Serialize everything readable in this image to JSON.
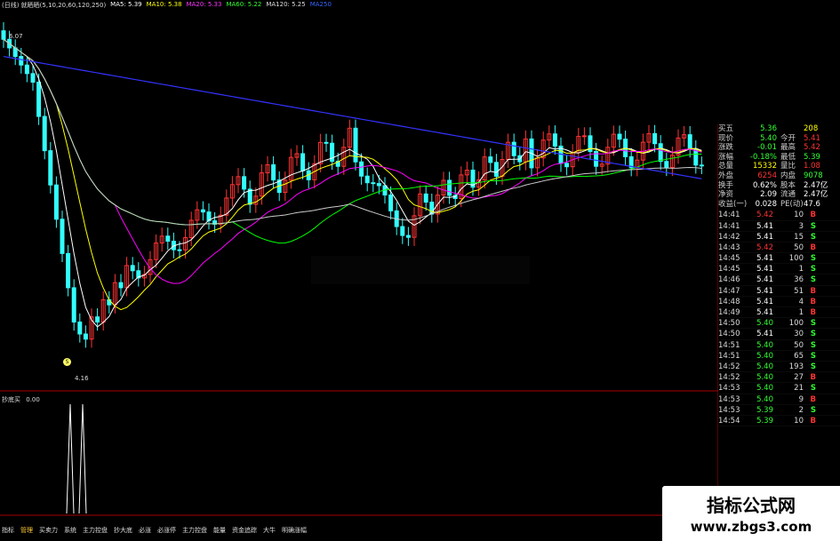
{
  "header": {
    "title": "(日线) 就晒晒(5,10,20,60,120,250)",
    "items": [
      {
        "label": "MA5: 5.39",
        "color": "#ffffff"
      },
      {
        "label": "MA10: 5.38",
        "color": "#ffff00"
      },
      {
        "label": "MA20: 5.33",
        "color": "#ff00ff"
      },
      {
        "label": "MA60: 5.22",
        "color": "#00ff00"
      },
      {
        "label": "MA120: 5.25",
        "color": "#cccccc"
      },
      {
        "label": "MA250",
        "color": "#3333ff"
      }
    ]
  },
  "price_labels": {
    "high": "6.07",
    "low": "4.16"
  },
  "low_marker": "S",
  "sub_chart": {
    "title": "抄底买",
    "value": "0.00"
  },
  "quote": {
    "rows": [
      {
        "l1": "买五",
        "v1": "5.36",
        "l2": "",
        "v2": "208",
        "c1": "#33ff33",
        "c2": "#ffff00"
      },
      {
        "l1": "现价",
        "v1": "5.40",
        "l2": "今开",
        "v2": "5.41",
        "c1": "#33ff33",
        "c2": "#ff3333"
      },
      {
        "l1": "涨跌",
        "v1": "-0.01",
        "l2": "最高",
        "v2": "5.42",
        "c1": "#33ff33",
        "c2": "#ff3333"
      },
      {
        "l1": "涨幅",
        "v1": "-0.18%",
        "l2": "最低",
        "v2": "5.39",
        "c1": "#33ff33",
        "c2": "#33ff33"
      },
      {
        "l1": "总量",
        "v1": "15332",
        "l2": "量比",
        "v2": "1.08",
        "c1": "#ffff00",
        "c2": "#ff3333"
      },
      {
        "l1": "外盘",
        "v1": "6254",
        "l2": "内盘",
        "v2": "9078",
        "c1": "#ff3333",
        "c2": "#33ff33"
      },
      {
        "l1": "换手",
        "v1": "0.62%",
        "l2": "股本",
        "v2": "2.47亿",
        "c1": "#ffffff",
        "c2": "#ffffff"
      },
      {
        "l1": "净资",
        "v1": "2.09",
        "l2": "流通",
        "v2": "2.47亿",
        "c1": "#ffffff",
        "c2": "#ffffff"
      },
      {
        "l1": "收益(一)",
        "v1": "0.028",
        "l2": "PE(动)",
        "v2": "47.6",
        "c1": "#ffffff",
        "c2": "#ffffff"
      }
    ],
    "ticks": [
      {
        "time": "14:41",
        "price": "5.42",
        "vol": "10",
        "side": "B"
      },
      {
        "time": "14:41",
        "price": "5.41",
        "vol": "3",
        "side": "S"
      },
      {
        "time": "14:42",
        "price": "5.41",
        "vol": "15",
        "side": "S"
      },
      {
        "time": "14:43",
        "price": "5.42",
        "vol": "50",
        "side": "B"
      },
      {
        "time": "14:45",
        "price": "5.41",
        "vol": "100",
        "side": "S"
      },
      {
        "time": "14:45",
        "price": "5.41",
        "vol": "1",
        "side": "S"
      },
      {
        "time": "14:46",
        "price": "5.41",
        "vol": "36",
        "side": "S"
      },
      {
        "time": "14:47",
        "price": "5.41",
        "vol": "51",
        "side": "B"
      },
      {
        "time": "14:48",
        "price": "5.41",
        "vol": "4",
        "side": "B"
      },
      {
        "time": "14:49",
        "price": "5.41",
        "vol": "1",
        "side": "B"
      },
      {
        "time": "14:50",
        "price": "5.40",
        "vol": "100",
        "side": "S"
      },
      {
        "time": "14:50",
        "price": "5.41",
        "vol": "30",
        "side": "S"
      },
      {
        "time": "14:51",
        "price": "5.40",
        "vol": "50",
        "side": "S"
      },
      {
        "time": "14:51",
        "price": "5.40",
        "vol": "65",
        "side": "S"
      },
      {
        "time": "14:52",
        "price": "5.40",
        "vol": "193",
        "side": "S"
      },
      {
        "time": "14:52",
        "price": "5.40",
        "vol": "27",
        "side": "B"
      },
      {
        "time": "14:53",
        "price": "5.40",
        "vol": "21",
        "side": "S"
      },
      {
        "time": "14:53",
        "price": "5.40",
        "vol": "9",
        "side": "B"
      },
      {
        "time": "14:53",
        "price": "5.39",
        "vol": "2",
        "side": "S"
      },
      {
        "time": "14:54",
        "price": "5.39",
        "vol": "10",
        "side": "B"
      }
    ]
  },
  "tabs": [
    "指标",
    "管理",
    "买卖力",
    "系统",
    "主力控盘",
    "抄大底",
    "必涨",
    "必涨停",
    "主力控盘",
    "能量",
    "资金追踪",
    "大牛",
    "明确涨幅"
  ],
  "active_tab": 1,
  "watermark": {
    "title": "指标公式网",
    "url": "www.zbgs3.com"
  },
  "colors": {
    "up": "#ff3333",
    "down": "#33ffff",
    "bg": "#000000",
    "ma5": "#ffffff",
    "ma10": "#ffff00",
    "ma20": "#ff00ff",
    "ma60": "#00ff00",
    "ma120": "#cccccc",
    "ma250": "#3333ff"
  }
}
